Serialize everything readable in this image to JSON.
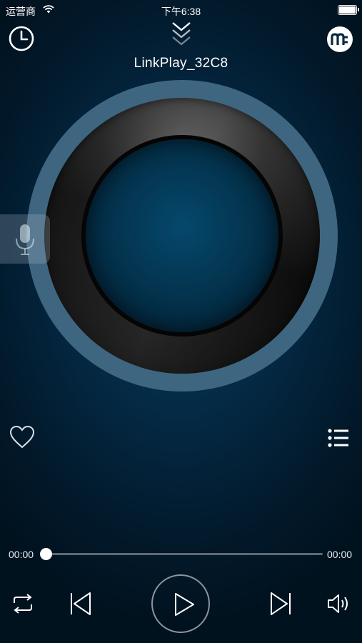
{
  "status_bar": {
    "carrier": "运营商",
    "time": "下午6:38"
  },
  "header": {
    "device_name": "LinkPlay_32C8",
    "icons": [
      "clock-icon",
      "collapse-chevron-icon",
      "muzo-logo-icon"
    ]
  },
  "player": {
    "elapsed": "00:00",
    "duration": "00:00",
    "progress": 0.0,
    "favorite": false
  },
  "controls": {
    "icons": [
      "repeat-icon",
      "previous-icon",
      "play-icon",
      "next-icon",
      "volume-icon"
    ]
  },
  "colors": {
    "background": "#042a45",
    "disc_rim": "#3f6680",
    "accent": "#ffffff"
  }
}
